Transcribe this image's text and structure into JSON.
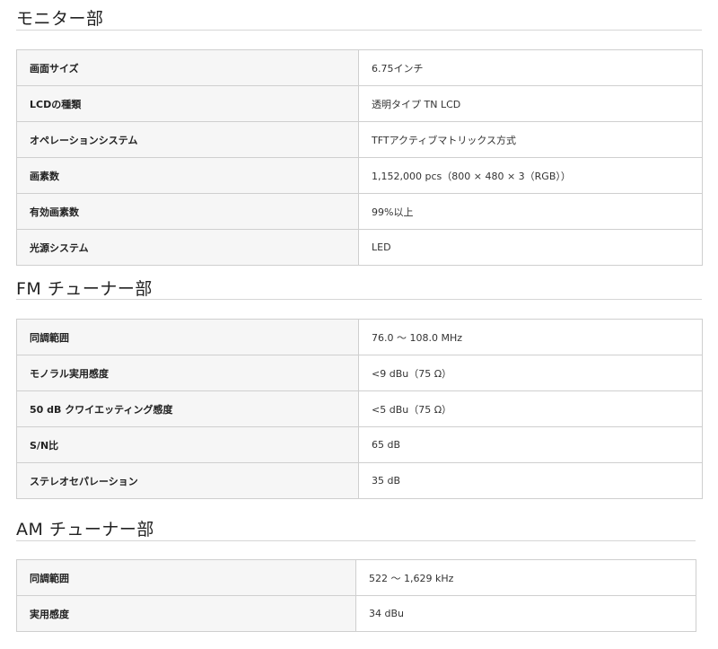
{
  "sections": [
    {
      "title": "モニター部",
      "rows": [
        {
          "label": "画面サイズ",
          "value": "6.75インチ"
        },
        {
          "label": "LCDの種類",
          "value": "透明タイプ TN LCD"
        },
        {
          "label": "オペレーションシステム",
          "value": "TFTアクティブマトリックス方式"
        },
        {
          "label": "画素数",
          "value": "1,152,000 pcs（800 × 480 × 3（RGB））"
        },
        {
          "label": "有効画素数",
          "value": "99%以上"
        },
        {
          "label": "光源システム",
          "value": "LED"
        }
      ]
    },
    {
      "title": "FM チューナー部",
      "rows": [
        {
          "label": "同調範囲",
          "value": "76.0 〜 108.0 MHz"
        },
        {
          "label": "モノラル実用感度",
          "value": "<9 dBu（75 Ω）"
        },
        {
          "label": "50 dB クワイエッティング感度",
          "value": "<5 dBu（75 Ω）"
        },
        {
          "label": "S/N比",
          "value": "65 dB"
        },
        {
          "label": "ステレオセパレーション",
          "value": "35 dB"
        }
      ]
    },
    {
      "title": "AM チューナー部",
      "rows": [
        {
          "label": "同調範囲",
          "value": "522 〜 1,629 kHz"
        },
        {
          "label": "実用感度",
          "value": "34 dBu"
        }
      ]
    }
  ]
}
